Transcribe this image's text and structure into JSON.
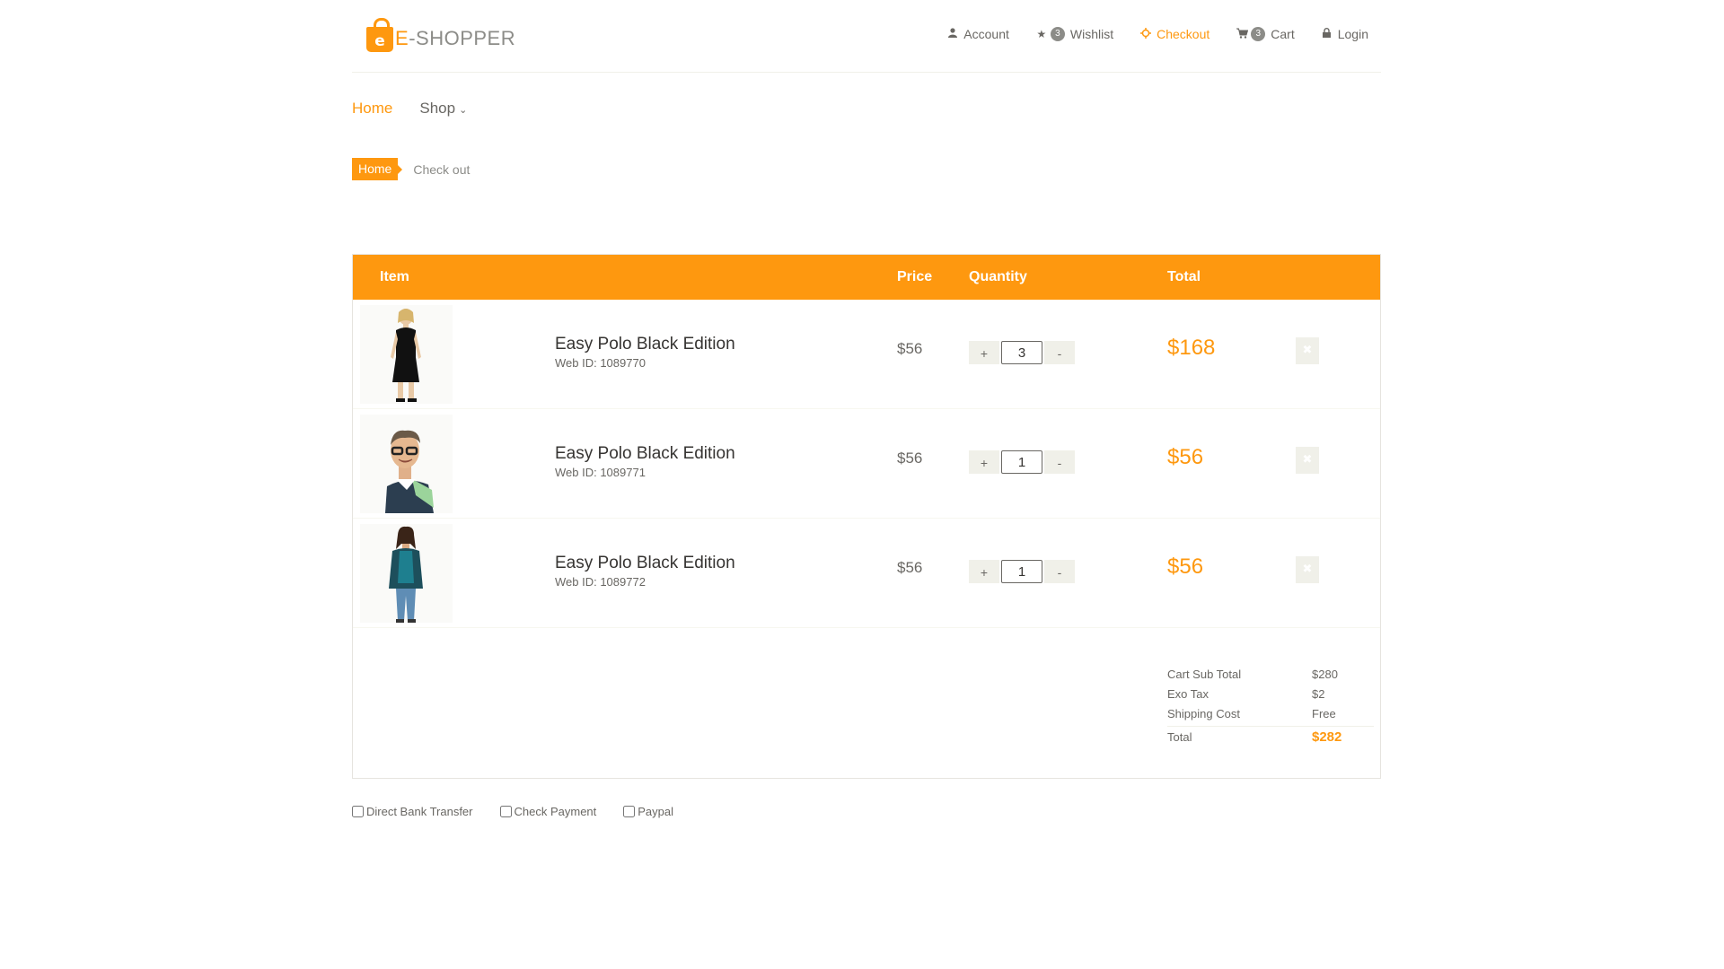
{
  "logo": {
    "icon_letter": "e",
    "text_first": "E",
    "text_rest": "-SHOPPER"
  },
  "top_nav": [
    {
      "icon": "user-icon",
      "label": "Account",
      "badge": null
    },
    {
      "icon": "star-icon",
      "label": "Wishlist",
      "badge": "3"
    },
    {
      "icon": "crosshairs-icon",
      "label": "Checkout",
      "badge": null,
      "active": true
    },
    {
      "icon": "shopping-cart-icon",
      "label": "Cart",
      "badge": "3"
    },
    {
      "icon": "lock-icon",
      "label": "Login",
      "badge": null
    }
  ],
  "main_nav": {
    "home": "Home",
    "shop": "Shop"
  },
  "breadcrumb": {
    "home": "Home",
    "current": "Check out"
  },
  "cart": {
    "headers": {
      "item": "Item",
      "price": "Price",
      "quantity": "Quantity",
      "total": "Total"
    },
    "qty_plus": "+",
    "qty_minus": "-",
    "rows": [
      {
        "name": "Easy Polo Black Edition",
        "web_id": "Web ID: 1089770",
        "price": "$56",
        "quantity": "3",
        "total": "$168",
        "image": "woman-black-dress"
      },
      {
        "name": "Easy Polo Black Edition",
        "web_id": "Web ID: 1089771",
        "price": "$56",
        "quantity": "1",
        "total": "$56",
        "image": "man-glasses-sweater"
      },
      {
        "name": "Easy Polo Black Edition",
        "web_id": "Web ID: 1089772",
        "price": "$56",
        "quantity": "1",
        "total": "$56",
        "image": "woman-teal-cardigan"
      }
    ],
    "summary": [
      {
        "label": "Cart Sub Total",
        "value": "$280"
      },
      {
        "label": "Exo Tax",
        "value": "$2"
      },
      {
        "label": "Shipping Cost",
        "value": "Free"
      },
      {
        "label": "Total",
        "value": "$282"
      }
    ]
  },
  "payment_options": [
    "Direct Bank Transfer",
    "Check Payment",
    "Paypal"
  ],
  "colors": {
    "accent": "#fe980f",
    "text": "#696763",
    "muted": "#8c8c88",
    "button_bg": "#f0f0e9"
  }
}
